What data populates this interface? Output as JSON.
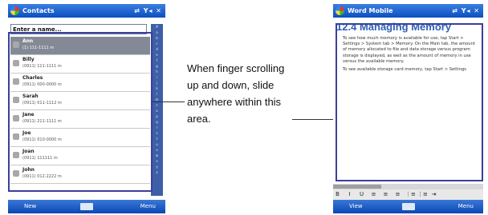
{
  "contacts_screen": {
    "title": "Contacts",
    "status_icons": "⇄ Y◂ ✕",
    "search_placeholder": "Enter a name...",
    "alphabet": [
      "#",
      "a",
      "b",
      "c",
      "d",
      "e",
      "f",
      "g",
      "h",
      "i",
      "j",
      "k",
      "l",
      "m",
      "n",
      "o",
      "p",
      "q",
      "r",
      "s",
      "t",
      "u",
      "v",
      "w",
      "x",
      "y",
      "z"
    ],
    "contacts": [
      {
        "name": "Ann",
        "phone": "(1) 111-1111  m",
        "selected": true
      },
      {
        "name": "Billy",
        "phone": "(0911) 111-1111  m",
        "selected": false
      },
      {
        "name": "Charles",
        "phone": "(0911) 000-0000  m",
        "selected": false
      },
      {
        "name": "Sarah",
        "phone": "(0911) 011-1112  m",
        "selected": false
      },
      {
        "name": "Jane",
        "phone": "(0911) 211-1111  m",
        "selected": false
      },
      {
        "name": "Joe",
        "phone": "(0911) 010-0000  m",
        "selected": false
      },
      {
        "name": "Joan",
        "phone": "(0911) 111111  m",
        "selected": false
      },
      {
        "name": "John",
        "phone": "(0911) 012-2222  m",
        "selected": false
      }
    ],
    "softkey_left": "New",
    "softkey_right": "Menu"
  },
  "caption": {
    "text": "When finger scrolling up and down, slide anywhere within this area."
  },
  "word_screen": {
    "title": "Word Mobile",
    "status_icons": "⇄ Y◂ ✕",
    "heading_number": "12.4",
    "heading_text": "Managing Memory",
    "paragraphs": [
      "To see how much memory is available for use, tap Start > Settings > System tab > Memory. On the Main tab, the amount of memory allocated to file and data storage versus program storage is displayed, as well as the amount of memory in use versus the available memory.",
      "To see available storage card memory, tap Start > Settings"
    ],
    "toolbar": [
      "B",
      "I",
      "U",
      "≡",
      "≡",
      "≡",
      "⋮≡",
      "⋮≡",
      "⇥"
    ],
    "softkey_left": "View",
    "softkey_right": "Menu"
  }
}
